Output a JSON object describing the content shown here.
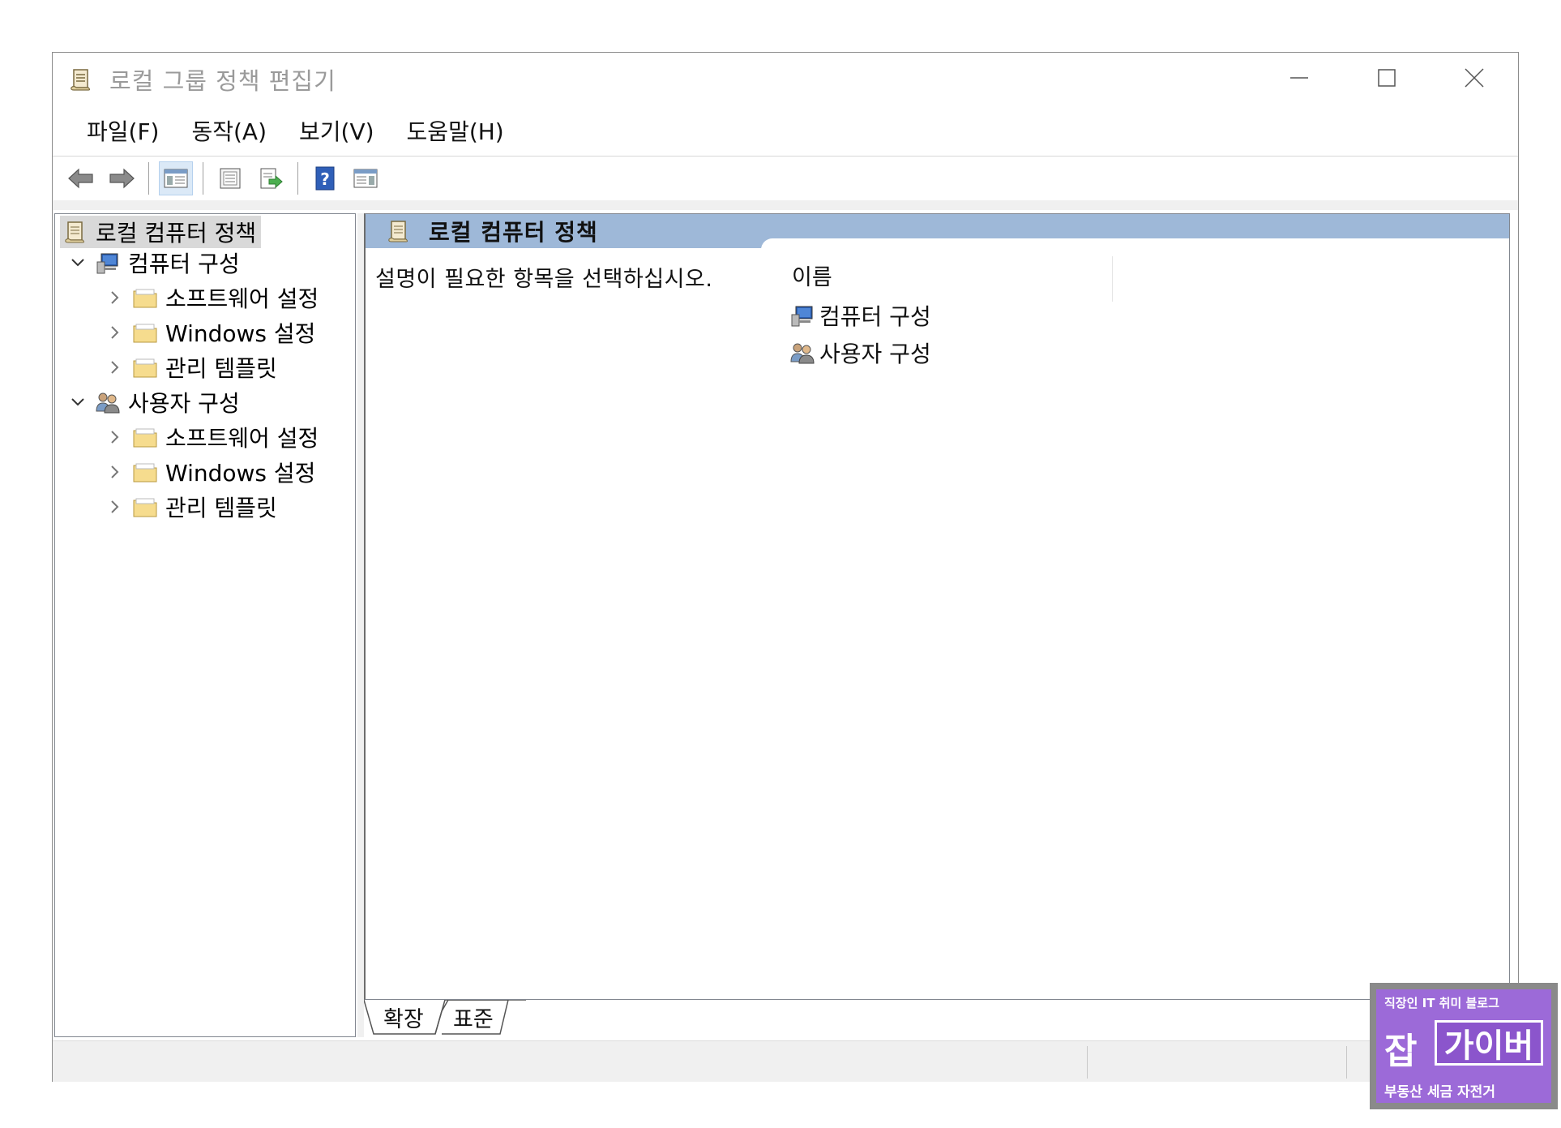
{
  "window": {
    "title": "로컬 그룹 정책 편집기"
  },
  "menu": {
    "items": [
      "파일(F)",
      "동작(A)",
      "보기(V)",
      "도움말(H)"
    ]
  },
  "toolbar": {
    "buttons": [
      "back-arrow-icon",
      "forward-arrow-icon",
      "show-hide-console-tree-icon",
      "properties-icon",
      "export-list-icon",
      "help-icon",
      "show-hide-action-pane-icon"
    ]
  },
  "tree": {
    "root": "로컬 컴퓨터 정책",
    "computer_config": {
      "label": "컴퓨터 구성",
      "children": [
        "소프트웨어 설정",
        "Windows 설정",
        "관리 템플릿"
      ]
    },
    "user_config": {
      "label": "사용자 구성",
      "children": [
        "소프트웨어 설정",
        "Windows 설정",
        "관리 템플릿"
      ]
    }
  },
  "detail": {
    "header": "로컬 컴퓨터 정책",
    "description": "설명이 필요한 항목을 선택하십시오.",
    "column_name": "이름",
    "items": [
      "컴퓨터 구성",
      "사용자 구성"
    ]
  },
  "tabs": {
    "extended": "확장",
    "standard": "표준"
  },
  "watermark": {
    "top": "직장인 IT 취미 블로그",
    "brand_left": "잡",
    "brand_right": "가이버",
    "bottom": "부동산 세금 자전거"
  },
  "colors": {
    "header_bar": "#9eb8d8",
    "selection": "#d9d9d9",
    "watermark": "#9c6ad8"
  }
}
